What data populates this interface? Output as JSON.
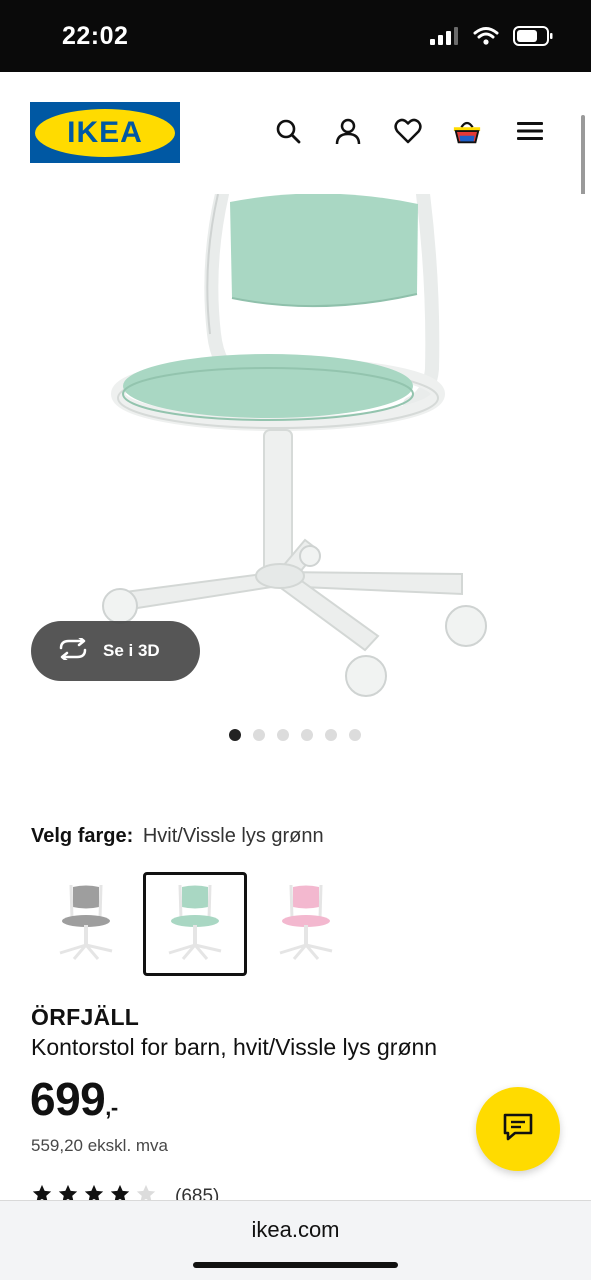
{
  "status_bar": {
    "time": "22:02"
  },
  "header": {
    "logo_text": "IKEA"
  },
  "gallery": {
    "view_3d_label": "Se i 3D",
    "total_images": 6,
    "active_index": 0
  },
  "color_selector": {
    "label": "Velg farge:",
    "value": "Hvit/Vissle lys grønn",
    "options": [
      "grey",
      "light-green",
      "pink"
    ],
    "selected_index": 1
  },
  "product": {
    "name": "ÖRFJÄLL",
    "description": "Kontorstol for barn, hvit/Vissle lys grønn",
    "price": "699",
    "price_suffix": ",-",
    "price_ex_vat": "559,20 ekskl. mva",
    "rating_stars": 4,
    "rating_max": 5,
    "review_count": "(685)"
  },
  "browser": {
    "url": "ikea.com"
  },
  "colors": {
    "brand_blue": "#0058a3",
    "brand_yellow": "#ffdb00",
    "seat_green": "#a9d7c3",
    "swatch_grey": "#9e9e9e",
    "swatch_pink": "#f3b8cf"
  }
}
